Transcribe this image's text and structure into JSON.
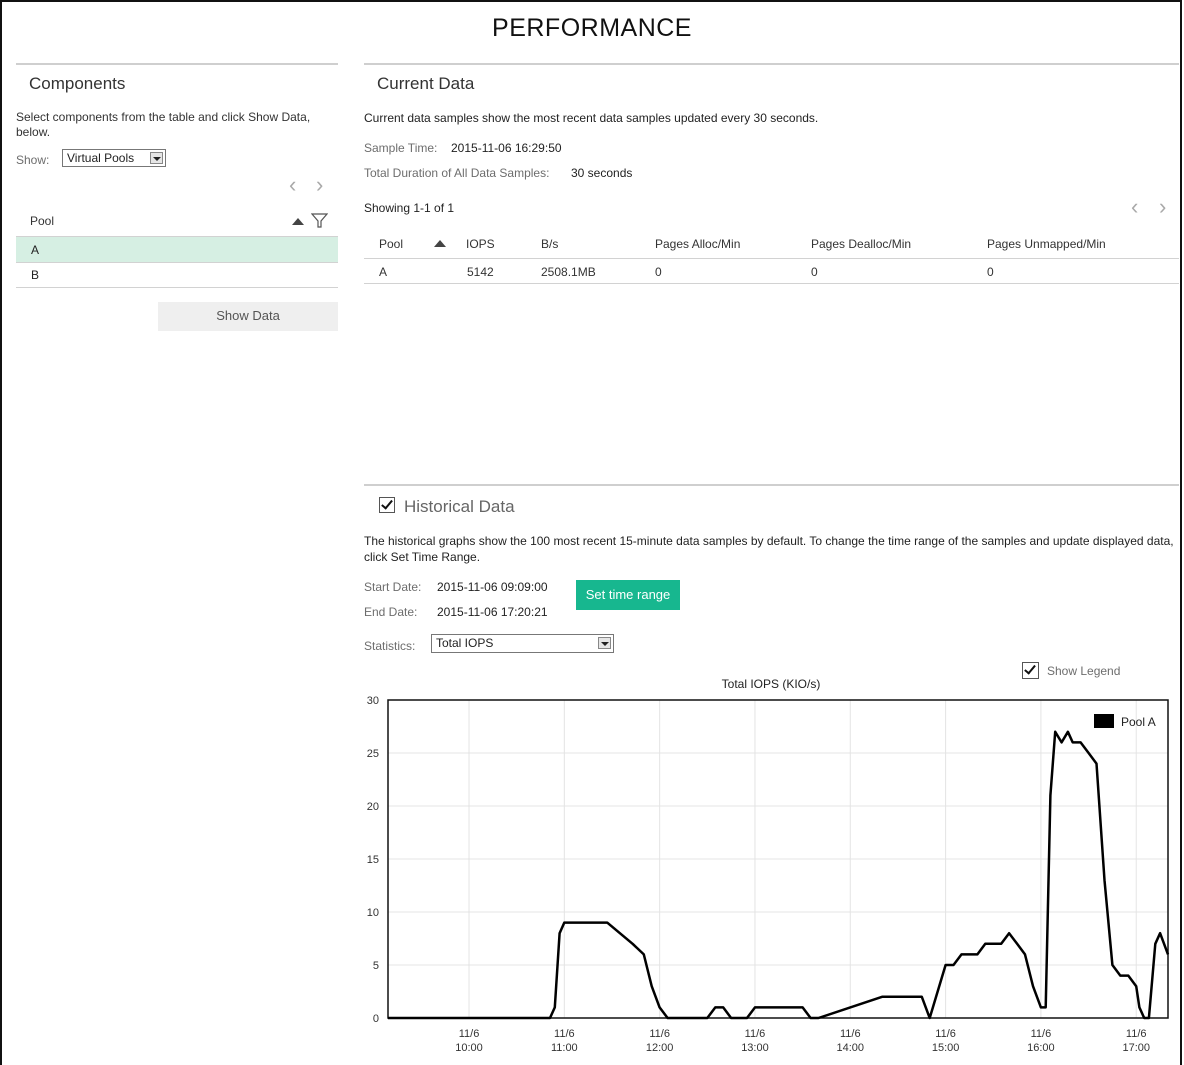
{
  "page": {
    "title": "PERFORMANCE"
  },
  "components": {
    "title": "Components",
    "instructions": "Select components from the table and click Show Data, below.",
    "show_label": "Show:",
    "show_value": "Virtual Pools",
    "table": {
      "column": "Pool",
      "rows": [
        "A",
        "B"
      ],
      "selected_row": "A"
    },
    "show_data_button": "Show Data"
  },
  "current": {
    "title": "Current Data",
    "description": "Current data samples show the most recent data samples updated every 30 seconds.",
    "sample_time_label": "Sample Time:",
    "sample_time_value": "2015-11-06 16:29:50",
    "duration_label": "Total Duration of All Data Samples:",
    "duration_value": "30 seconds",
    "showing": "Showing 1-1 of 1",
    "columns": [
      "Pool",
      "IOPS",
      "B/s",
      "Pages Alloc/Min",
      "Pages Dealloc/Min",
      "Pages Unmapped/Min"
    ],
    "rows": [
      [
        "A",
        "5142",
        "2508.1MB",
        "0",
        "0",
        "0"
      ]
    ]
  },
  "historical": {
    "title": "Historical Data",
    "description": "The historical graphs show the 100 most recent 15-minute data samples by default. To change the time range of the samples and update displayed data, click Set Time Range.",
    "start_label": "Start Date:",
    "start_value": "2015-11-06 09:09:00",
    "end_label": "End Date:",
    "end_value": "2015-11-06 17:20:21",
    "set_time_range_button": "Set time range",
    "statistics_label": "Statistics:",
    "statistics_value": "Total IOPS",
    "show_legend_label": "Show Legend"
  },
  "chart_data": {
    "type": "line",
    "title": "Total IOPS (KIO/s)",
    "xlabel": "",
    "ylabel": "",
    "ylim": [
      0,
      30
    ],
    "yticks": [
      0,
      5,
      10,
      15,
      20,
      25,
      30
    ],
    "xlim": [
      "2015-11-06 09:09",
      "2015-11-06 17:20"
    ],
    "xticks": [
      {
        "date": "11/6",
        "time": "10:00",
        "x": "2015-11-06 10:00"
      },
      {
        "date": "11/6",
        "time": "11:00",
        "x": "2015-11-06 11:00"
      },
      {
        "date": "11/6",
        "time": "12:00",
        "x": "2015-11-06 12:00"
      },
      {
        "date": "11/6",
        "time": "13:00",
        "x": "2015-11-06 13:00"
      },
      {
        "date": "11/6",
        "time": "14:00",
        "x": "2015-11-06 14:00"
      },
      {
        "date": "11/6",
        "time": "15:00",
        "x": "2015-11-06 15:00"
      },
      {
        "date": "11/6",
        "time": "16:00",
        "x": "2015-11-06 16:00"
      },
      {
        "date": "11/6",
        "time": "17:00",
        "x": "2015-11-06 17:00"
      }
    ],
    "legend_position": "top-right",
    "grid": true,
    "series": [
      {
        "name": "Pool A",
        "color": "#000000",
        "x": [
          "2015-11-06 09:09",
          "2015-11-06 10:51",
          "2015-11-06 10:54",
          "2015-11-06 10:57",
          "2015-11-06 11:00",
          "2015-11-06 11:03",
          "2015-11-06 11:10",
          "2015-11-06 11:20",
          "2015-11-06 11:27",
          "2015-11-06 11:35",
          "2015-11-06 11:43",
          "2015-11-06 11:50",
          "2015-11-06 11:55",
          "2015-11-06 12:00",
          "2015-11-06 12:05",
          "2015-11-06 12:30",
          "2015-11-06 12:35",
          "2015-11-06 12:40",
          "2015-11-06 12:45",
          "2015-11-06 12:50",
          "2015-11-06 12:55",
          "2015-11-06 13:00",
          "2015-11-06 13:25",
          "2015-11-06 13:30",
          "2015-11-06 13:35",
          "2015-11-06 13:40",
          "2015-11-06 14:20",
          "2015-11-06 14:30",
          "2015-11-06 14:35",
          "2015-11-06 14:40",
          "2015-11-06 14:45",
          "2015-11-06 14:50",
          "2015-11-06 15:00",
          "2015-11-06 15:05",
          "2015-11-06 15:10",
          "2015-11-06 15:15",
          "2015-11-06 15:20",
          "2015-11-06 15:25",
          "2015-11-06 15:30",
          "2015-11-06 15:35",
          "2015-11-06 15:40",
          "2015-11-06 15:45",
          "2015-11-06 15:50",
          "2015-11-06 15:55",
          "2015-11-06 16:00",
          "2015-11-06 16:03",
          "2015-11-06 16:06",
          "2015-11-06 16:09",
          "2015-11-06 16:13",
          "2015-11-06 16:17",
          "2015-11-06 16:20",
          "2015-11-06 16:25",
          "2015-11-06 16:30",
          "2015-11-06 16:35",
          "2015-11-06 16:40",
          "2015-11-06 16:45",
          "2015-11-06 16:50",
          "2015-11-06 16:55",
          "2015-11-06 17:00",
          "2015-11-06 17:02",
          "2015-11-06 17:05",
          "2015-11-06 17:08",
          "2015-11-06 17:12",
          "2015-11-06 17:15",
          "2015-11-06 17:20"
        ],
        "y": [
          0,
          0,
          1,
          8,
          9,
          9,
          9,
          9,
          9,
          8,
          7,
          6,
          3,
          1,
          0,
          0,
          1,
          1,
          0,
          0,
          0,
          1,
          1,
          1,
          0,
          0,
          2,
          2,
          2,
          2,
          2,
          0,
          5,
          5,
          6,
          6,
          6,
          7,
          7,
          7,
          8,
          7,
          6,
          3,
          1,
          1,
          21,
          27,
          26,
          27,
          26,
          26,
          25,
          24,
          13,
          5,
          4,
          4,
          3,
          1,
          0,
          0,
          7,
          8,
          6
        ]
      }
    ]
  }
}
